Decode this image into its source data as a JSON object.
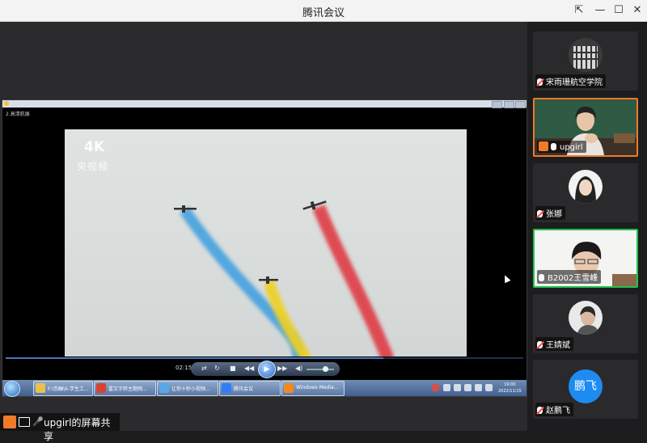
{
  "window": {
    "title": "腾讯会议",
    "controls": [
      "pin",
      "minimize",
      "maximize",
      "close"
    ]
  },
  "player": {
    "file_name": "2.高清航展",
    "current_time": "02:15",
    "progress": 0.73,
    "watermark_4k": "4K",
    "watermark_channel": "央视频",
    "volume_level": 0.68
  },
  "taskbar": {
    "items": [
      {
        "label": "F:\\伤酗\\6-学生工...",
        "icon_color": "#e8c24a"
      },
      {
        "label": "富文字转主题网...",
        "icon_color": "#d84234"
      },
      {
        "label": "让你十秒小视频...",
        "icon_color": "#5aa7e6"
      },
      {
        "label": "腾讯会议",
        "icon_color": "#2f7ef5"
      },
      {
        "label": "Windows Media...",
        "icon_color": "#f08a20"
      }
    ],
    "clock_time": "19:00",
    "clock_date": "2022/11/15"
  },
  "share_status": {
    "text": "upgirl的屏幕共享"
  },
  "participants": [
    {
      "name": "宋雨珊航空学院",
      "muted": true
    },
    {
      "name": "upgirl",
      "muted": false,
      "host": true
    },
    {
      "name": "张娜",
      "muted": true
    },
    {
      "name": "B2002王雪峰",
      "muted": false,
      "speaking": true
    },
    {
      "name": "王婧斌",
      "muted": true
    },
    {
      "name": "赵鹏飞",
      "muted": true,
      "avatar_text": "鹏飞",
      "avatar_color": "#1e8bf2"
    }
  ],
  "colors": {
    "accent_orange": "#f07a2a",
    "speaking_green": "#23c24e",
    "smoke_blue": "#3a9ee0",
    "smoke_yellow": "#f0d020",
    "smoke_red": "#e0303a"
  }
}
